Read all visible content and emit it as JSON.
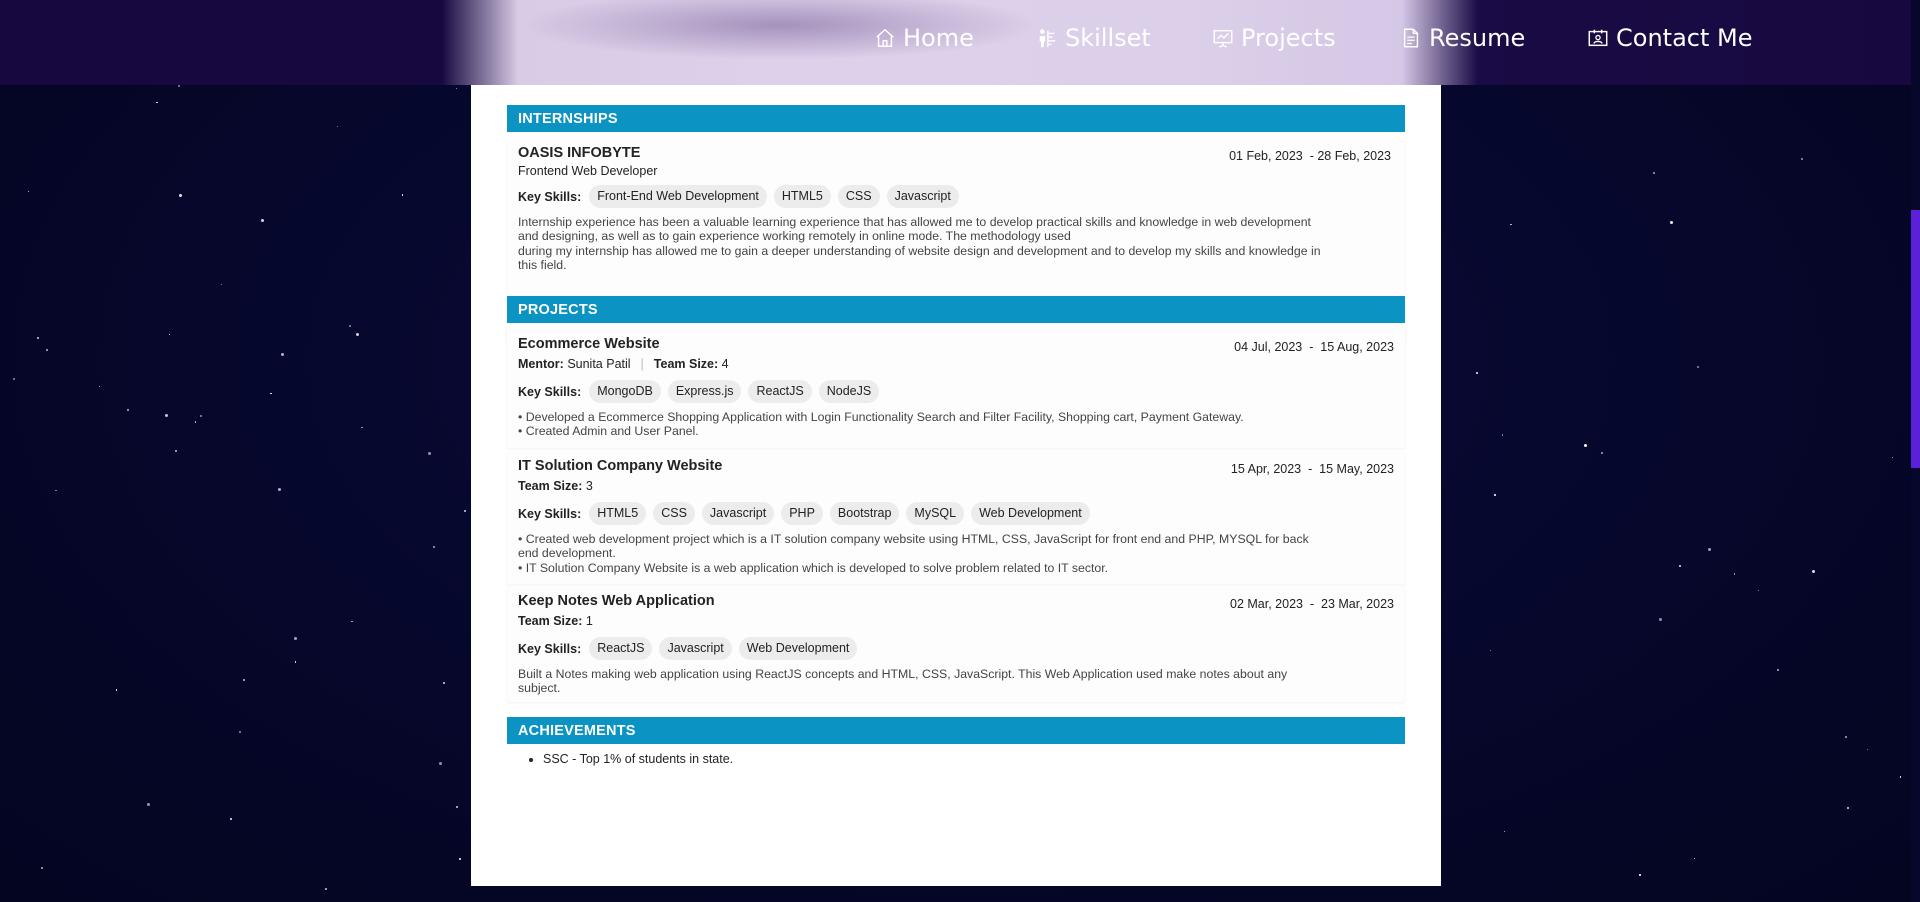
{
  "nav": {
    "home": "Home",
    "skillset": "Skillset",
    "projects": "Projects",
    "resume": "Resume",
    "contact": "Contact Me"
  },
  "internships": {
    "heading": "INTERNSHIPS",
    "items": [
      {
        "company": "OASIS INFOBYTE",
        "role": "Frontend Web Developer",
        "date": "01 Feb, 2023  - 28 Feb, 2023",
        "skills_label": "Key Skills:",
        "skills": [
          "Front-End Web Development",
          "HTML5",
          "CSS",
          "Javascript"
        ],
        "description": [
          "Internship experience has been a valuable learning experience that has allowed me to develop practical skills and knowledge in web development",
          "and designing, as well as to gain experience working remotely in online mode. The methodology used",
          "during my internship has allowed me to gain a deeper understanding of website design and development and to develop my skills and knowledge in",
          "this field."
        ]
      }
    ]
  },
  "projects": {
    "heading": "PROJECTS",
    "items": [
      {
        "title": "Ecommerce Website",
        "mentor_label": "Mentor:",
        "mentor": "Sunita Patil",
        "team_label": "Team Size:",
        "team": "4",
        "date": "04 Jul, 2023  -  15 Aug, 2023",
        "skills_label": "Key Skills:",
        "skills": [
          "MongoDB",
          "Express.js",
          "ReactJS",
          "NodeJS"
        ],
        "description": [
          "• Developed a Ecommerce Shopping Application with Login Functionality Search and Filter Facility, Shopping cart, Payment Gateway.",
          "• Created Admin and User Panel."
        ]
      },
      {
        "title": "IT Solution Company Website",
        "team_label": "Team Size:",
        "team": "3",
        "date": "15 Apr, 2023  -  15 May, 2023",
        "skills_label": "Key Skills:",
        "skills": [
          "HTML5",
          "CSS",
          "Javascript",
          "PHP",
          "Bootstrap",
          "MySQL",
          "Web Development"
        ],
        "description": [
          "• Created web development project which is a IT solution company website using HTML, CSS, JavaScript for front end and PHP, MYSQL for back",
          "end development.",
          "• IT Solution Company Website is a web application which is developed to solve problem related to IT sector."
        ]
      },
      {
        "title": "Keep Notes Web Application",
        "team_label": "Team Size:",
        "team": "1",
        "date": "02 Mar, 2023  -  23 Mar, 2023",
        "skills_label": "Key Skills:",
        "skills": [
          "ReactJS",
          "Javascript",
          "Web Development"
        ],
        "description": [
          "Built a Notes making web application using ReactJS concepts and HTML, CSS, JavaScript. This Web Application used make notes about any",
          "subject."
        ]
      }
    ]
  },
  "achievements": {
    "heading": "ACHIEVEMENTS",
    "items": [
      "SSC - Top 1% of students in state."
    ]
  },
  "colors": {
    "section_header": "#0b93c4",
    "background": "#06072b",
    "scroll_thumb": "#5b21d8"
  },
  "icons": {
    "home": "home-icon",
    "skillset": "people-skill-icon",
    "projects": "presentation-icon",
    "resume": "document-icon",
    "contact": "contact-card-icon"
  }
}
